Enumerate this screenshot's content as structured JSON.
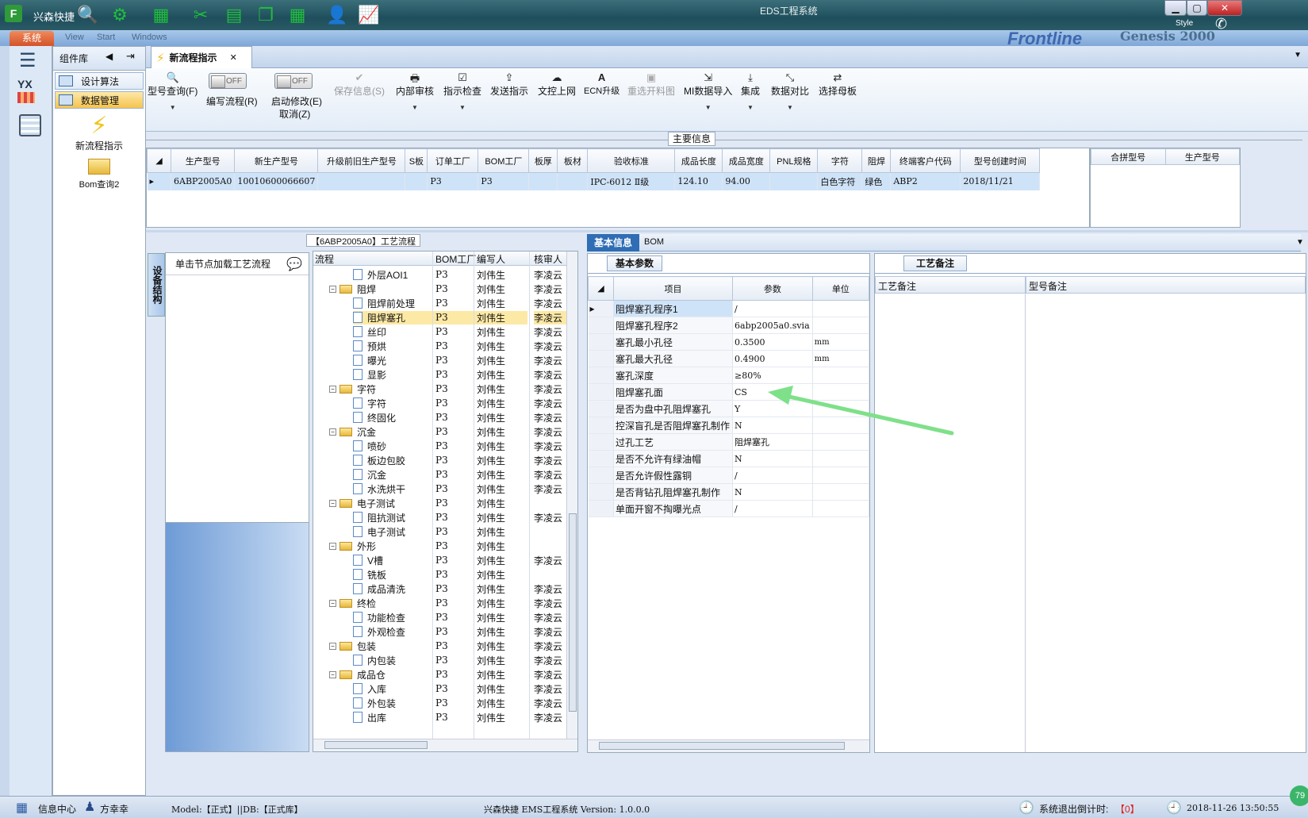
{
  "window": {
    "app_name": "兴森快捷",
    "title": "EDS工程系统",
    "style_label": "Style"
  },
  "menu": {
    "system": "系统",
    "items": [
      "View",
      "Start",
      "Windows"
    ],
    "brand": "Frontline",
    "brand2": "Genesis 2000"
  },
  "left_strip": {
    "logo_text": "YX"
  },
  "component_library": {
    "title": "组件库",
    "items": [
      {
        "label": "设计算法"
      },
      {
        "label": "数据管理"
      }
    ],
    "big_items": [
      {
        "label": "新流程指示"
      },
      {
        "label": "Bom查询2"
      }
    ]
  },
  "tab": {
    "label": "新流程指示"
  },
  "ribbon": {
    "model_query": "型号查询(F)",
    "write_flow": "编写流程(R)",
    "start_modify": "启动修改(E)",
    "cancel": "取消(Z)",
    "toggle_off": "OFF",
    "save_info": "保存信息(S)",
    "internal_review": "内部审核",
    "indicator_check": "指示检查",
    "send_indicator": "发送指示",
    "upload_control": "文控上网",
    "ecn_upgrade": "ECN升级",
    "reselect_chart": "重选开料图",
    "mi_import": "MI数据导入",
    "integrate": "集成",
    "data_compare": "数据对比",
    "select_master": "选择母板"
  },
  "main_info": {
    "title": "主要信息",
    "columns": [
      "生产型号",
      "新生产型号",
      "升级前旧生产型号",
      "S板",
      "订单工厂",
      "BOM工厂",
      "板厚",
      "板材",
      "验收标准",
      "成品长度",
      "成品宽度",
      "PNL规格",
      "字符",
      "阻焊",
      "终端客户代码",
      "型号创建时间"
    ],
    "row": [
      "6ABP2005A0",
      "10010600066607",
      "",
      "",
      "P3",
      "P3",
      "",
      "",
      "IPC-6012 Ⅱ级",
      "124.10",
      "94.00",
      "",
      "白色字符",
      "绿色",
      "ABP2",
      "2018/11/21"
    ],
    "right_columns": [
      "合拼型号",
      "生产型号"
    ]
  },
  "process": {
    "title": "【6ABP2005A0】工艺流程",
    "side_tab": "设备结构",
    "hint": "单击节点加载工艺流程",
    "columns": [
      "流程",
      "BOM工厂",
      "编写人",
      "核审人"
    ],
    "rows": [
      {
        "name": "外层AOI1",
        "level": 2,
        "bom": "P3",
        "writer": "刘伟生",
        "reviewer": "李凌云"
      },
      {
        "name": "阻焊",
        "level": 1,
        "bom": "P3",
        "writer": "刘伟生",
        "reviewer": "李凌云"
      },
      {
        "name": "阻焊前处理",
        "level": 2,
        "bom": "P3",
        "writer": "刘伟生",
        "reviewer": "李凌云"
      },
      {
        "name": "阻焊塞孔",
        "level": 2,
        "bom": "P3",
        "writer": "刘伟生",
        "reviewer": "李凌云"
      },
      {
        "name": "丝印",
        "level": 2,
        "bom": "P3",
        "writer": "刘伟生",
        "reviewer": "李凌云"
      },
      {
        "name": "预烘",
        "level": 2,
        "bom": "P3",
        "writer": "刘伟生",
        "reviewer": "李凌云"
      },
      {
        "name": "曝光",
        "level": 2,
        "bom": "P3",
        "writer": "刘伟生",
        "reviewer": "李凌云"
      },
      {
        "name": "显影",
        "level": 2,
        "bom": "P3",
        "writer": "刘伟生",
        "reviewer": "李凌云"
      },
      {
        "name": "字符",
        "level": 1,
        "bom": "P3",
        "writer": "刘伟生",
        "reviewer": "李凌云"
      },
      {
        "name": "字符",
        "level": 2,
        "bom": "P3",
        "writer": "刘伟生",
        "reviewer": "李凌云"
      },
      {
        "name": "终固化",
        "level": 2,
        "bom": "P3",
        "writer": "刘伟生",
        "reviewer": "李凌云"
      },
      {
        "name": "沉金",
        "level": 1,
        "bom": "P3",
        "writer": "刘伟生",
        "reviewer": "李凌云"
      },
      {
        "name": "喷砂",
        "level": 2,
        "bom": "P3",
        "writer": "刘伟生",
        "reviewer": "李凌云"
      },
      {
        "name": "板边包胶",
        "level": 2,
        "bom": "P3",
        "writer": "刘伟生",
        "reviewer": "李凌云"
      },
      {
        "name": "沉金",
        "level": 2,
        "bom": "P3",
        "writer": "刘伟生",
        "reviewer": "李凌云"
      },
      {
        "name": "水洗烘干",
        "level": 2,
        "bom": "P3",
        "writer": "刘伟生",
        "reviewer": "李凌云"
      },
      {
        "name": "电子测试",
        "level": 1,
        "bom": "P3",
        "writer": "刘伟生",
        "reviewer": ""
      },
      {
        "name": "阻抗测试",
        "level": 2,
        "bom": "P3",
        "writer": "刘伟生",
        "reviewer": "李凌云"
      },
      {
        "name": "电子测试",
        "level": 2,
        "bom": "P3",
        "writer": "刘伟生",
        "reviewer": ""
      },
      {
        "name": "外形",
        "level": 1,
        "bom": "P3",
        "writer": "刘伟生",
        "reviewer": ""
      },
      {
        "name": "V槽",
        "level": 2,
        "bom": "P3",
        "writer": "刘伟生",
        "reviewer": "李凌云"
      },
      {
        "name": "铣板",
        "level": 2,
        "bom": "P3",
        "writer": "刘伟生",
        "reviewer": ""
      },
      {
        "name": "成品清洗",
        "level": 2,
        "bom": "P3",
        "writer": "刘伟生",
        "reviewer": "李凌云"
      },
      {
        "name": "终检",
        "level": 1,
        "bom": "P3",
        "writer": "刘伟生",
        "reviewer": "李凌云"
      },
      {
        "name": "功能检查",
        "level": 2,
        "bom": "P3",
        "writer": "刘伟生",
        "reviewer": "李凌云"
      },
      {
        "name": "外观检查",
        "level": 2,
        "bom": "P3",
        "writer": "刘伟生",
        "reviewer": "李凌云"
      },
      {
        "name": "包装",
        "level": 1,
        "bom": "P3",
        "writer": "刘伟生",
        "reviewer": "李凌云"
      },
      {
        "name": "内包装",
        "level": 2,
        "bom": "P3",
        "writer": "刘伟生",
        "reviewer": "李凌云"
      },
      {
        "name": "成品仓",
        "level": 1,
        "bom": "P3",
        "writer": "刘伟生",
        "reviewer": "李凌云"
      },
      {
        "name": "入库",
        "level": 2,
        "bom": "P3",
        "writer": "刘伟生",
        "reviewer": "李凌云"
      },
      {
        "name": "外包装",
        "level": 2,
        "bom": "P3",
        "writer": "刘伟生",
        "reviewer": "李凌云"
      },
      {
        "name": "出库",
        "level": 2,
        "bom": "P3",
        "writer": "刘伟生",
        "reviewer": "李凌云"
      }
    ],
    "selected_index": 3
  },
  "basic_info": {
    "tabs": [
      "基本信息",
      "BOM"
    ],
    "sub_tab": "基本参数",
    "columns": [
      "项目",
      "参数",
      "单位"
    ],
    "rows": [
      {
        "item": "阻焊塞孔程序1",
        "param": "/",
        "unit": ""
      },
      {
        "item": "阻焊塞孔程序2",
        "param": "6abp2005a0.svia",
        "unit": ""
      },
      {
        "item": "塞孔最小孔径",
        "param": "0.3500",
        "unit": "mm"
      },
      {
        "item": "塞孔最大孔径",
        "param": "0.4900",
        "unit": "mm"
      },
      {
        "item": "塞孔深度",
        "param": "≥80%",
        "unit": ""
      },
      {
        "item": "阻焊塞孔面",
        "param": "CS",
        "unit": ""
      },
      {
        "item": "是否为盘中孔阻焊塞孔",
        "param": "Y",
        "unit": ""
      },
      {
        "item": "控深盲孔是否阻焊塞孔制作",
        "param": "N",
        "unit": ""
      },
      {
        "item": "过孔工艺",
        "param": "阻焊塞孔",
        "unit": ""
      },
      {
        "item": "是否不允许有绿油帽",
        "param": "N",
        "unit": ""
      },
      {
        "item": "是否允许假性露铜",
        "param": "/",
        "unit": ""
      },
      {
        "item": "是否背钻孔阻焊塞孔制作",
        "param": "N",
        "unit": ""
      },
      {
        "item": "单面开窗不掏曝光点",
        "param": "/",
        "unit": ""
      }
    ]
  },
  "process_notes": {
    "tab": "工艺备注",
    "columns": [
      "工艺备注",
      "型号备注"
    ]
  },
  "status": {
    "info_center": "信息中心",
    "user": "方幸幸",
    "model": "Model:【正式】||DB:【正式库】",
    "app_version": "兴森快捷 EMS工程系统 Version: 1.0.0.0",
    "countdown_label": "系统退出倒计时:",
    "countdown": "【0】",
    "datetime": "2018-11-26 13:50:55",
    "badge": "79"
  },
  "colors": {
    "accent": "#3d7fd0",
    "selected_row": "#fde9a6",
    "arrow": "#7fe08a"
  }
}
